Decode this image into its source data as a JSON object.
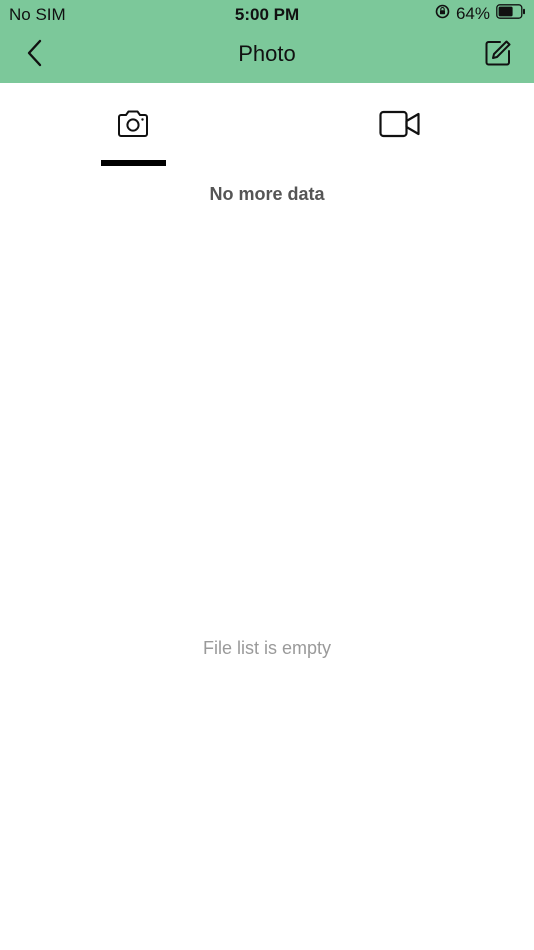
{
  "status_bar": {
    "carrier": "No SIM",
    "time": "5:00 PM",
    "battery_percent": "64%",
    "battery_level": 0.64,
    "icons": [
      "orientation-lock-icon",
      "battery-icon"
    ]
  },
  "nav": {
    "title": "Photo",
    "back_icon": "chevron-left-icon",
    "edit_icon": "edit-icon"
  },
  "tabs": [
    {
      "key": "photo",
      "icon": "camera-icon",
      "selected": true
    },
    {
      "key": "video",
      "icon": "video-camera-icon",
      "selected": false
    }
  ],
  "list": {
    "footer_text": "No more data",
    "empty_text": "File list is empty"
  },
  "colors": {
    "header_bg": "#7cc89a",
    "indicator": "#000000",
    "empty_text": "#9a9a9a"
  }
}
